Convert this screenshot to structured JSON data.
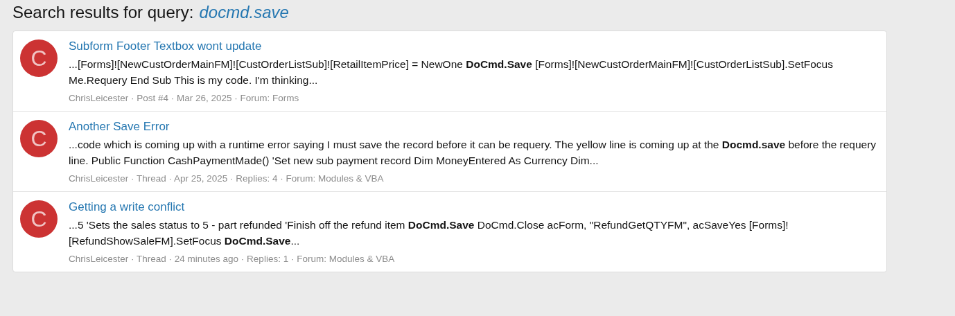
{
  "heading": {
    "label": "Search results for query:",
    "query": "docmd.save"
  },
  "results": [
    {
      "avatar": "C",
      "title": "Subform Footer Textbox wont update",
      "snippet": "...[Forms]![NewCustOrderMainFM]![CustOrderListSub]![RetailItemPrice] = NewOne **DoCmd.Save** [Forms]![NewCustOrderMainFM]![CustOrderListSub].SetFocus Me.Requery End Sub This is my code. I'm thinking...",
      "meta": "ChrisLeicester · Post #4 · Mar 26, 2025 · Forum: Forms"
    },
    {
      "avatar": "C",
      "title": "Another Save Error",
      "snippet": "...code which is coming up with a runtime error saying I must save the record before it can be requery. The yellow line is coming up at the **Docmd.save** before the requery line. Public Function CashPaymentMade() 'Set new sub payment record Dim MoneyEntered As Currency Dim...",
      "meta": "ChrisLeicester · Thread · Apr 25, 2025 · Replies: 4 · Forum: Modules & VBA"
    },
    {
      "avatar": "C",
      "title": "Getting a write conflict",
      "snippet": "...5 'Sets the sales status to 5 - part refunded 'Finish off the refund item **DoCmd.Save** DoCmd.Close acForm, \"RefundGetQTYFM\", acSaveYes [Forms]![RefundShowSaleFM].SetFocus **DoCmd.Save**...",
      "meta": "ChrisLeicester · Thread · 24 minutes ago · Replies: 1 · Forum: Modules & VBA"
    }
  ]
}
